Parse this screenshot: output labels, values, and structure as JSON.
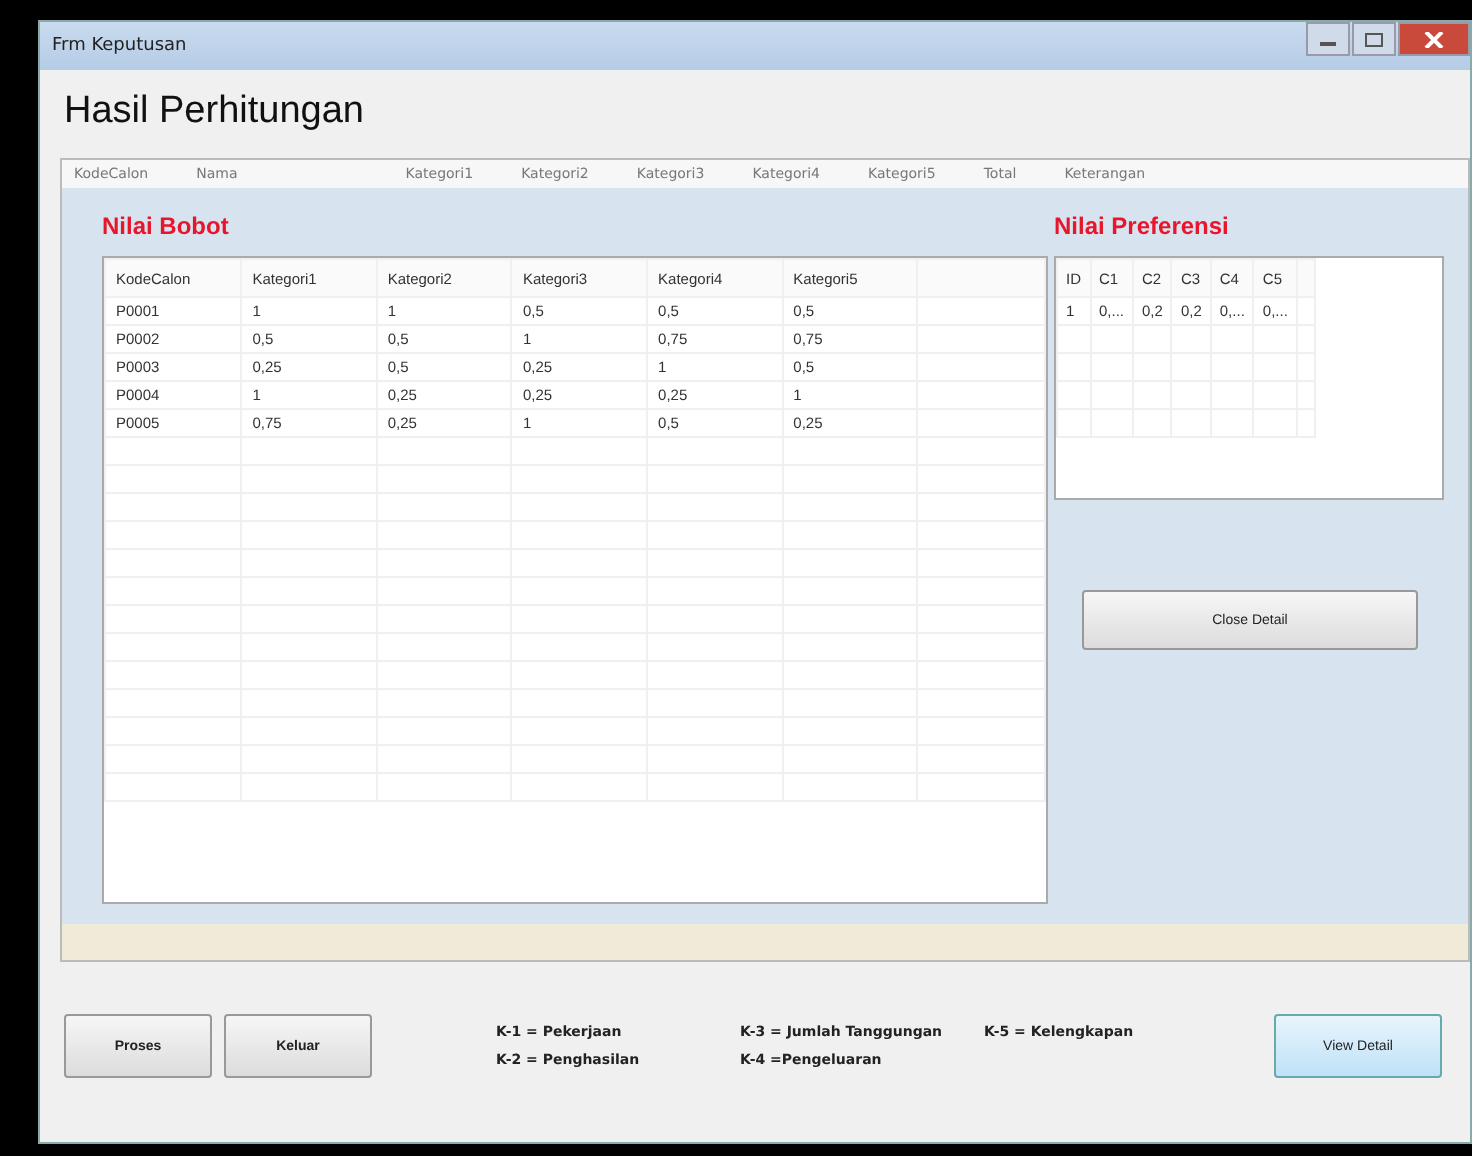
{
  "window": {
    "title": "Frm Keputusan"
  },
  "heading": "Hasil Perhitungan",
  "back_grid": {
    "columns": [
      "KodeCalon",
      "Nama",
      "Kategori1",
      "Kategori2",
      "Kategori3",
      "Kategori4",
      "Kategori5",
      "Total",
      "Keterangan"
    ]
  },
  "bobot": {
    "title": "Nilai Bobot",
    "columns": [
      "KodeCalon",
      "Kategori1",
      "Kategori2",
      "Kategori3",
      "Kategori4",
      "Kategori5"
    ],
    "rows": [
      [
        "P0001",
        "1",
        "1",
        "0,5",
        "0,5",
        "0,5"
      ],
      [
        "P0002",
        "0,5",
        "0,5",
        "1",
        "0,75",
        "0,75"
      ],
      [
        "P0003",
        "0,25",
        "0,5",
        "0,25",
        "1",
        "0,5"
      ],
      [
        "P0004",
        "1",
        "0,25",
        "0,25",
        "0,25",
        "1"
      ],
      [
        "P0005",
        "0,75",
        "0,25",
        "1",
        "0,5",
        "0,25"
      ]
    ]
  },
  "preferensi": {
    "title": "Nilai Preferensi",
    "columns": [
      "ID",
      "C1",
      "C2",
      "C3",
      "C4",
      "C5"
    ],
    "rows": [
      [
        "1",
        "0,...",
        "0,2",
        "0,2",
        "0,...",
        "0,..."
      ]
    ]
  },
  "close_button": "Close Detail",
  "buttons": [
    "Proses",
    "Keluar"
  ],
  "legend": [
    "K-1 = Pekerjaan",
    "K-2 = Penghasilan",
    "K-3 = Jumlah Tanggungan",
    "K-4 =Pengeluaran",
    "K-5 = Kelengkapan"
  ],
  "view_button": "View Detail"
}
